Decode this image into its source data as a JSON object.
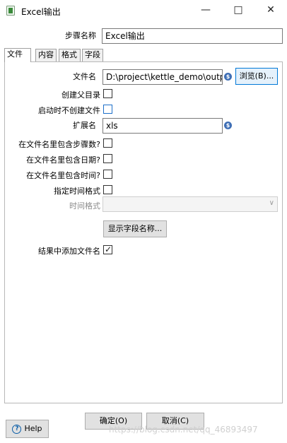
{
  "window": {
    "title": "Excel输出",
    "minimize_icon": "minimize-icon",
    "maximize_icon": "maximize-icon",
    "close_icon": "close-icon"
  },
  "step_name": {
    "label": "步骤名称",
    "value": "Excel输出"
  },
  "tabs": [
    {
      "label": "文件",
      "active": true
    },
    {
      "label": "内容",
      "active": false
    },
    {
      "label": "格式",
      "active": false
    },
    {
      "label": "字段",
      "active": false
    }
  ],
  "file_tab": {
    "filename": {
      "label": "文件名",
      "value": "D:\\project\\kettle_demo\\outp",
      "browse_label": "浏览(B)..."
    },
    "create_parent_dir": {
      "label": "创建父目录",
      "checked": false
    },
    "no_create_on_start": {
      "label": "启动时不创建文件",
      "checked": false
    },
    "extension": {
      "label": "扩展名",
      "value": "xls"
    },
    "include_stepnr": {
      "label": "在文件名里包含步骤数?",
      "checked": false
    },
    "include_date": {
      "label": "在文件名里包含日期?",
      "checked": false
    },
    "include_time": {
      "label": "在文件名里包含时间?",
      "checked": false
    },
    "specify_format": {
      "label": "指定时间格式",
      "checked": false
    },
    "time_format": {
      "label": "时间格式",
      "value": ""
    },
    "show_fields_label": "显示字段名称...",
    "add_to_result": {
      "label": "结果中添加文件名",
      "checked": true
    }
  },
  "buttons": {
    "ok": "确定(O)",
    "cancel": "取消(C)",
    "help": "Help"
  },
  "watermark": "https://blog.csdn.net/qq_46893497"
}
